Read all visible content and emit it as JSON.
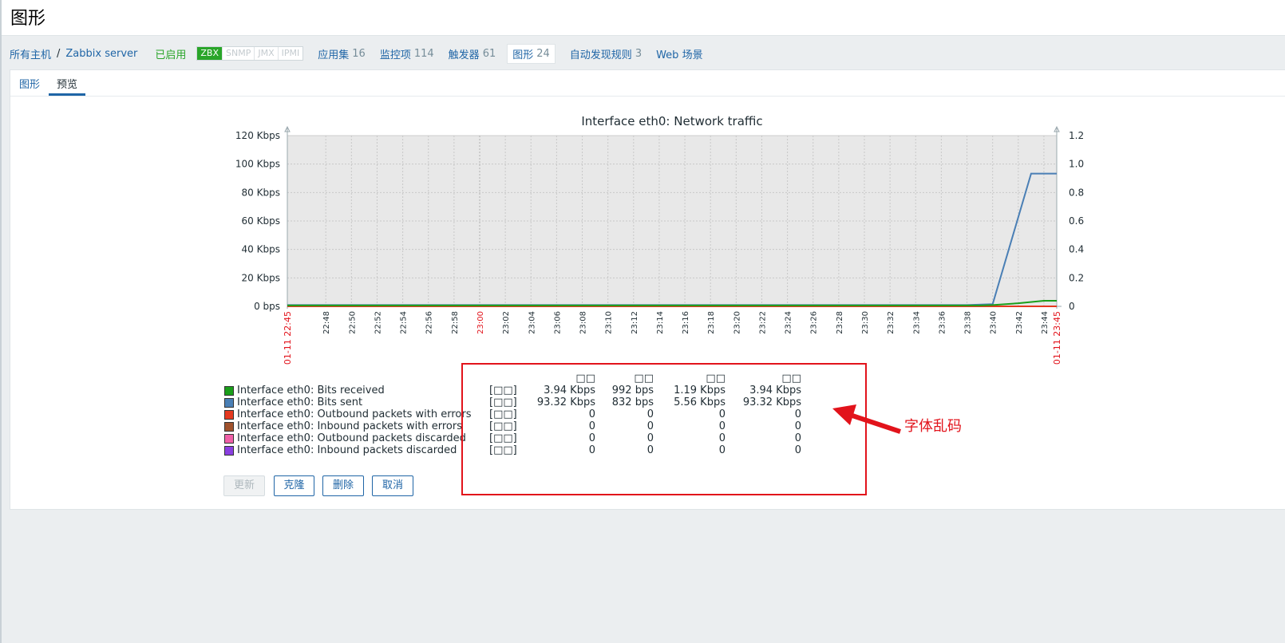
{
  "page": {
    "title": "图形"
  },
  "breadcrumb": {
    "all_hosts": "所有主机",
    "separator": "/",
    "host": "Zabbix server",
    "status": "已启用",
    "badges": [
      "ZBX",
      "SNMP",
      "JMX",
      "IPMI"
    ],
    "items": [
      {
        "label": "应用集",
        "count": "16"
      },
      {
        "label": "监控项",
        "count": "114"
      },
      {
        "label": "触发器",
        "count": "61"
      },
      {
        "label": "图形",
        "count": "24"
      },
      {
        "label": "自动发现规则",
        "count": "3"
      },
      {
        "label": "Web 场景",
        "count": ""
      }
    ]
  },
  "tabs": [
    {
      "label": "图形"
    },
    {
      "label": "预览"
    }
  ],
  "colors": {
    "link": "#1f65a6",
    "enabled": "#29a529",
    "annotation": "#e2131b",
    "plot_bg": "#e8e8e8"
  },
  "chart_data": {
    "type": "line",
    "title": "Interface eth0: Network traffic",
    "y_left_ticks": [
      "120 Kbps",
      "100 Kbps",
      "80 Kbps",
      "60 Kbps",
      "40 Kbps",
      "20 Kbps",
      "0 bps"
    ],
    "y_right_ticks": [
      "1.2",
      "1.0",
      "0.8",
      "0.6",
      "0.4",
      "0.2",
      "0"
    ],
    "ylim_left_kbps": [
      0,
      120
    ],
    "ylim_right": [
      0,
      1.2
    ],
    "x_start_label": "01-11 22:45",
    "x_end_label": "01-11 23:45",
    "x_ticks": [
      "22:48",
      "22:50",
      "22:52",
      "22:54",
      "22:56",
      "22:58",
      "23:00",
      "23:02",
      "23:04",
      "23:06",
      "23:08",
      "23:10",
      "23:12",
      "23:14",
      "23:16",
      "23:18",
      "23:20",
      "23:22",
      "23:24",
      "23:26",
      "23:28",
      "23:30",
      "23:32",
      "23:34",
      "23:36",
      "23:38",
      "23:40",
      "23:42",
      "23:44"
    ],
    "x_ticks_minutes": [
      3,
      5,
      7,
      9,
      11,
      13,
      15,
      17,
      19,
      21,
      23,
      25,
      27,
      29,
      31,
      33,
      35,
      37,
      39,
      41,
      43,
      45,
      47,
      49,
      51,
      53,
      55,
      57,
      59
    ],
    "x_range_minutes": [
      0,
      60
    ],
    "grid": true,
    "series": [
      {
        "name": "Interface eth0: Bits received",
        "color": "#1a9e1a",
        "points": [
          [
            0,
            0.6
          ],
          [
            54,
            0.6
          ],
          [
            55,
            0.9
          ],
          [
            57,
            2.2
          ],
          [
            59,
            3.9
          ],
          [
            60,
            3.94
          ]
        ]
      },
      {
        "name": "Interface eth0: Bits sent",
        "color": "#4a7fb5",
        "points": [
          [
            0,
            0.9
          ],
          [
            53,
            0.9
          ],
          [
            55,
            1.5
          ],
          [
            58,
            93.32
          ],
          [
            60,
            93.32
          ]
        ]
      },
      {
        "name": "Interface eth0: Outbound packets with errors",
        "color": "#e53920",
        "points": [
          [
            0,
            0
          ],
          [
            60,
            0
          ]
        ]
      },
      {
        "name": "Interface eth0: Inbound packets with errors",
        "color": "#a0522d",
        "points": [
          [
            0,
            0
          ],
          [
            60,
            0
          ]
        ]
      },
      {
        "name": "Interface eth0: Outbound packets discarded",
        "color": "#f060a8",
        "points": [
          [
            0,
            0
          ],
          [
            60,
            0
          ]
        ]
      },
      {
        "name": "Interface eth0: Inbound packets discarded",
        "color": "#8a3fe0",
        "points": [
          [
            0,
            0
          ],
          [
            60,
            0
          ]
        ]
      }
    ]
  },
  "legend": {
    "headers": [
      "□□",
      "□□",
      "□□",
      "□□"
    ],
    "function": "[□□]",
    "rows": [
      {
        "name": "Interface eth0: Bits received",
        "color": "#1a9e1a",
        "values": [
          "3.94 Kbps",
          "992 bps",
          "1.19 Kbps",
          "3.94 Kbps"
        ]
      },
      {
        "name": "Interface eth0: Bits sent",
        "color": "#4a7fb5",
        "values": [
          "93.32 Kbps",
          "832 bps",
          "5.56 Kbps",
          "93.32 Kbps"
        ]
      },
      {
        "name": "Interface eth0: Outbound packets with errors",
        "color": "#e53920",
        "values": [
          "0",
          "0",
          "0",
          "0"
        ]
      },
      {
        "name": "Interface eth0: Inbound packets with errors",
        "color": "#a0522d",
        "values": [
          "0",
          "0",
          "0",
          "0"
        ]
      },
      {
        "name": "Interface eth0: Outbound packets discarded",
        "color": "#f060a8",
        "values": [
          "0",
          "0",
          "0",
          "0"
        ]
      },
      {
        "name": "Interface eth0: Inbound packets discarded",
        "color": "#8a3fe0",
        "values": [
          "0",
          "0",
          "0",
          "0"
        ]
      }
    ]
  },
  "buttons": {
    "update": "更新",
    "clone": "克隆",
    "delete": "删除",
    "cancel": "取消"
  },
  "annotation": {
    "text": "字体乱码"
  }
}
